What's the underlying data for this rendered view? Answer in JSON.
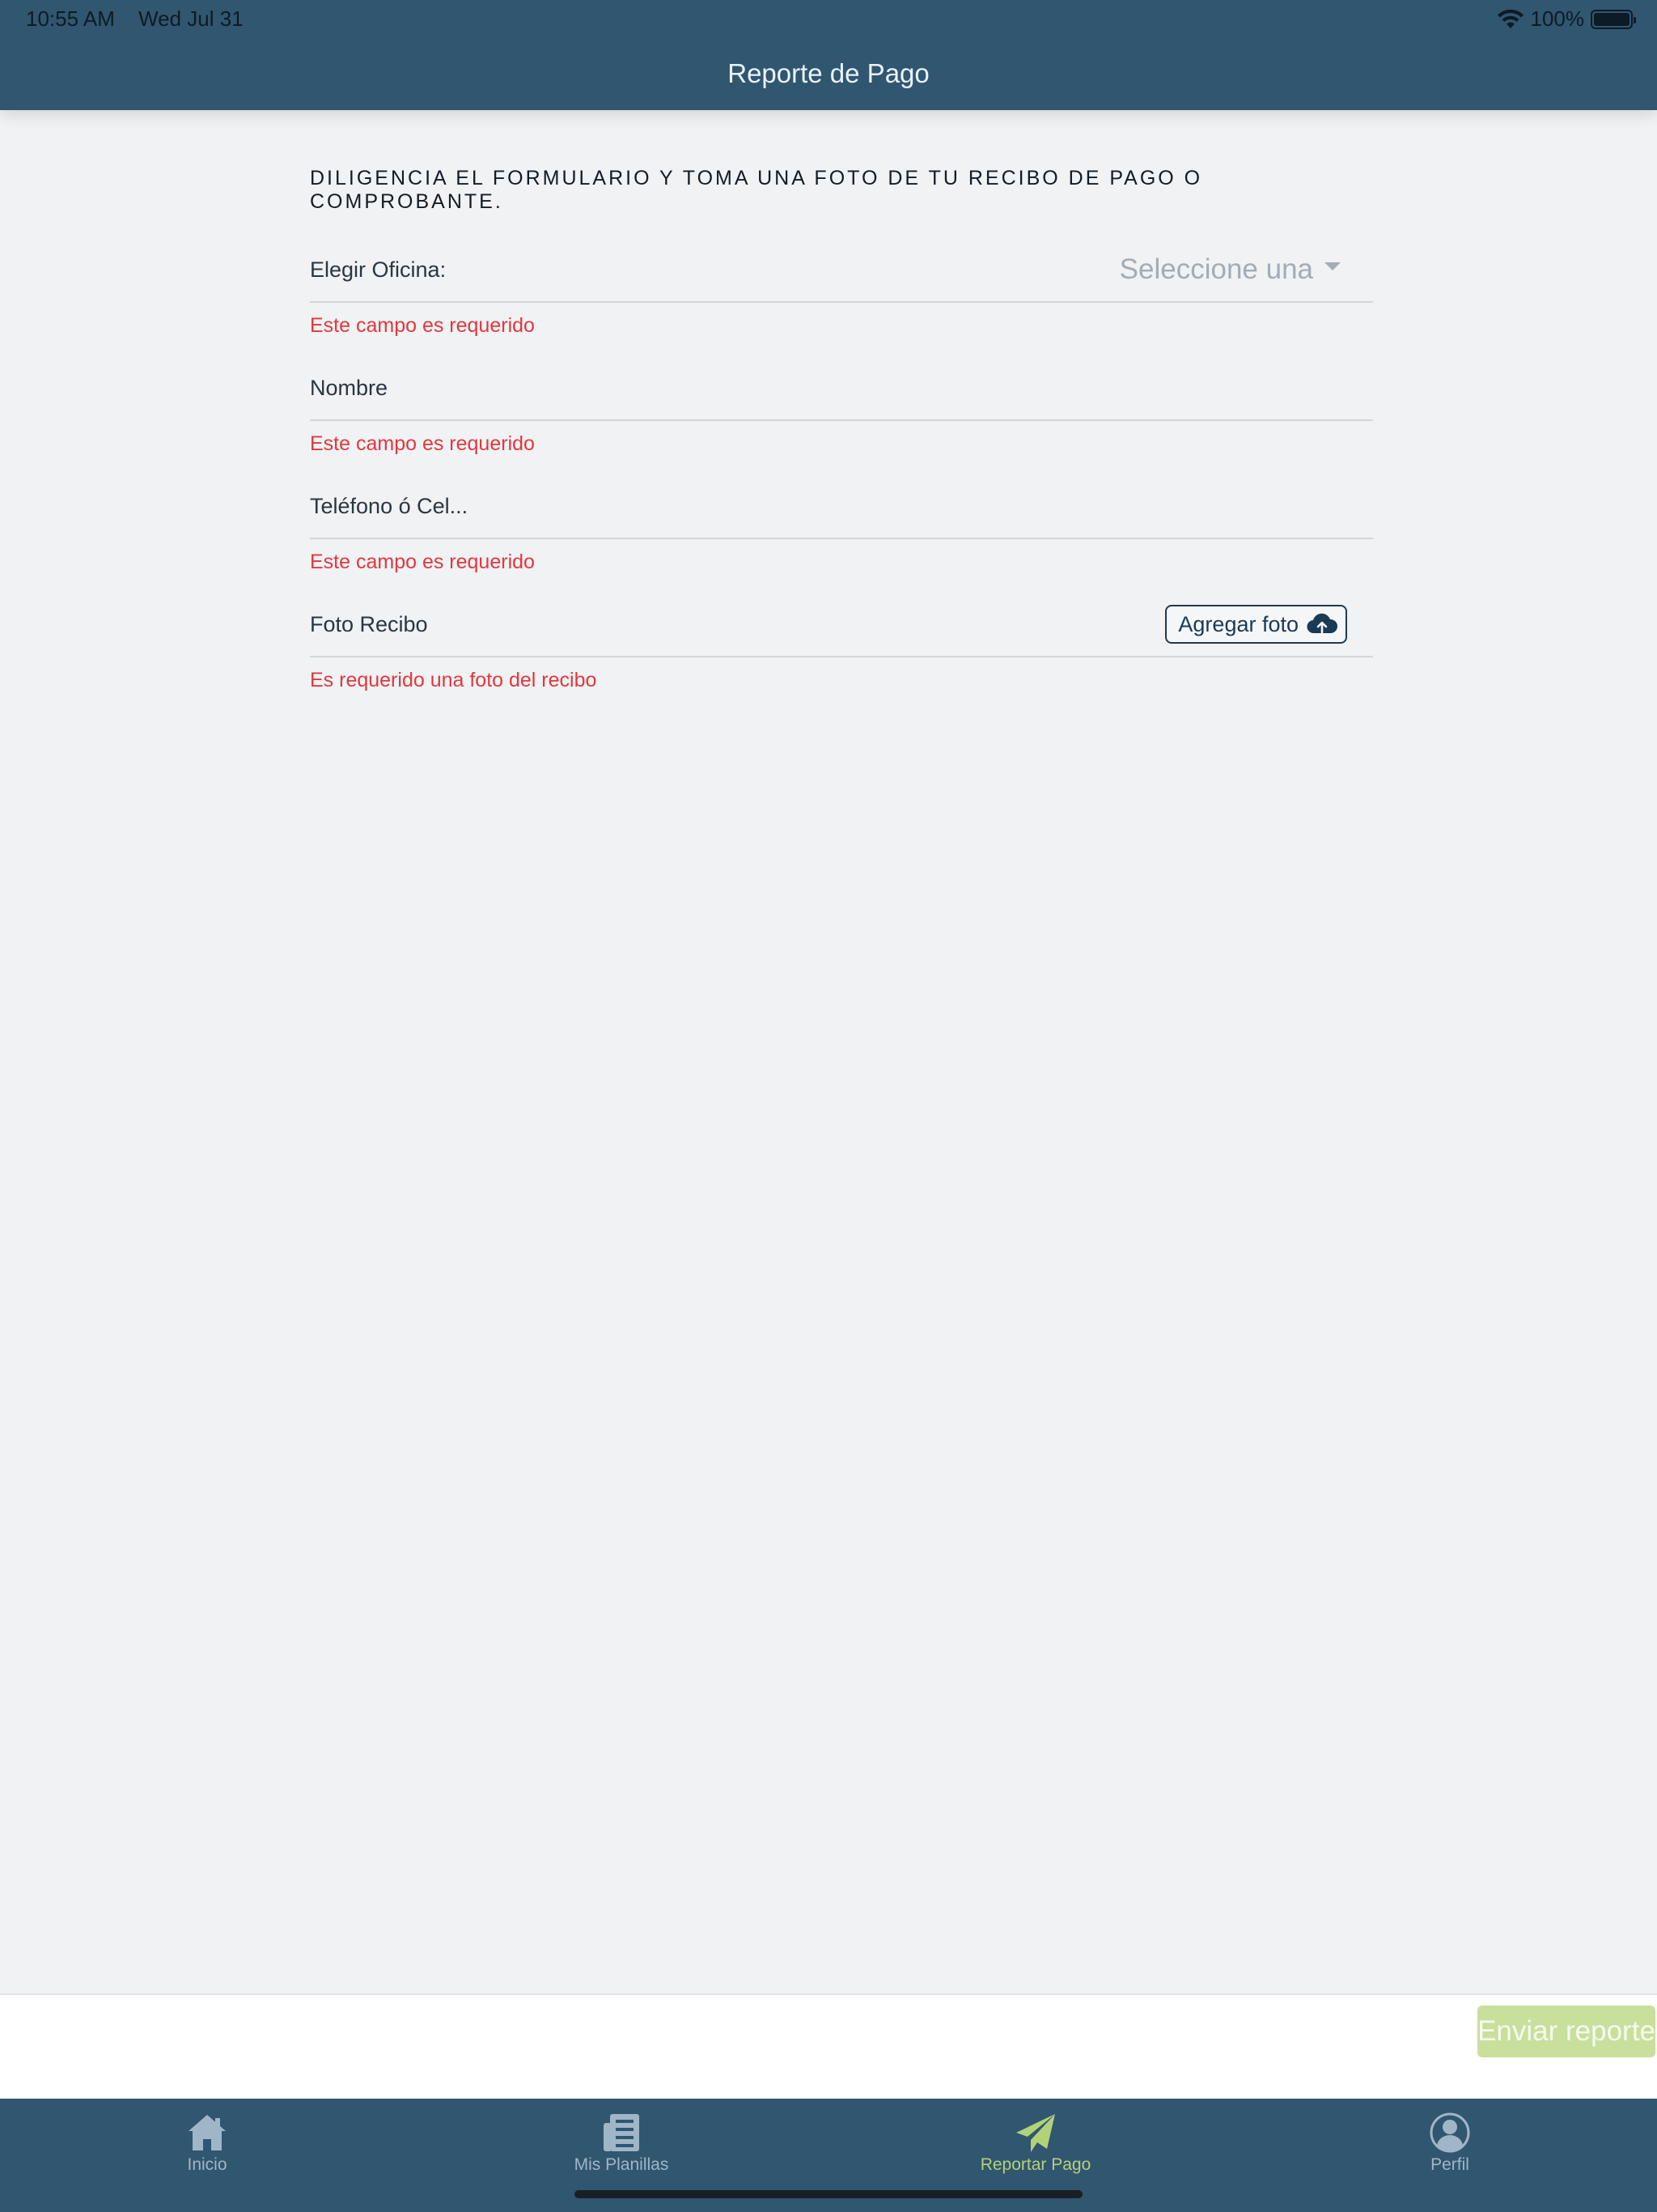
{
  "status_bar": {
    "time": "10:55 AM",
    "date": "Wed Jul 31",
    "battery": "100%"
  },
  "header": {
    "title": "Reporte de Pago"
  },
  "form": {
    "instructions": "DILIGENCIA EL FORMULARIO Y TOMA UNA FOTO DE TU RECIBO DE PAGO O COMPROBANTE.",
    "office": {
      "label": "Elegir Oficina:",
      "select_value": "Seleccione una",
      "error": "Este campo es requerido"
    },
    "name": {
      "placeholder": "Nombre",
      "error": "Este campo es requerido"
    },
    "phone": {
      "placeholder": "Teléfono ó Cel...",
      "error": "Este campo es requerido"
    },
    "photo": {
      "label": "Foto Recibo",
      "button_label": "Agregar foto",
      "error": "Es requerido una foto del recibo"
    }
  },
  "footer": {
    "send_label": "Enviar reporte"
  },
  "tabs": [
    {
      "label": "Inicio",
      "icon": "home-icon"
    },
    {
      "label": "Mis Planillas",
      "icon": "document-icon"
    },
    {
      "label": "Reportar Pago",
      "icon": "paper-plane-icon",
      "active": true
    },
    {
      "label": "Perfil",
      "icon": "profile-icon"
    }
  ],
  "colors": {
    "header_bg": "#31566f",
    "page_bg": "#f0f2f4",
    "error": "#e0383e",
    "active_tab": "#b2d27a",
    "inactive_tab": "#9fb6c8",
    "send_button": "#c8e09c"
  }
}
